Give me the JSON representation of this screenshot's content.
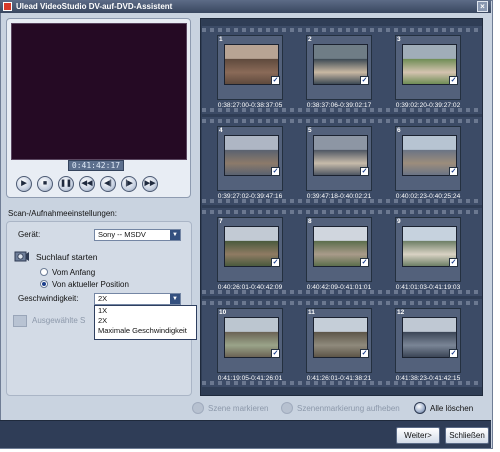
{
  "window": {
    "title": "Ulead VideoStudio DV-auf-DVD-Assistent",
    "close_glyph": "×"
  },
  "player": {
    "timecode": "0:41:42:17",
    "controls": [
      {
        "name": "play-button",
        "glyph": "▶"
      },
      {
        "name": "stop-button",
        "glyph": "■"
      },
      {
        "name": "pause-button",
        "glyph": "❚❚"
      },
      {
        "name": "rewind-button",
        "glyph": "◀◀"
      },
      {
        "name": "step-back-button",
        "glyph": "◀|"
      },
      {
        "name": "step-forward-button",
        "glyph": "|▶"
      },
      {
        "name": "fast-forward-button",
        "glyph": "▶▶"
      }
    ]
  },
  "settings": {
    "section_label": "Scan-/Aufnahmeeinstellungen:",
    "device_label": "Gerät:",
    "device_value": "Sony -- MSDV",
    "scan_start_label": "Suchlauf starten",
    "radio_from_start": "Vom Anfang",
    "radio_from_current": "Von aktueller Position",
    "speed_label": "Geschwindigkeit:",
    "speed_value": "2X",
    "speed_options": [
      "1X",
      "2X",
      "Maximale Geschwindigkeit"
    ],
    "save_selected_label": "Ausgewählte S"
  },
  "scenes": [
    {
      "num": "1",
      "timecode": "0:38:27:00-0:38:37:05"
    },
    {
      "num": "2",
      "timecode": "0:38:37:06-0:39:02:17"
    },
    {
      "num": "3",
      "timecode": "0:39:02:20-0:39:27:02"
    },
    {
      "num": "4",
      "timecode": "0:39:27:02-0:39:47:16"
    },
    {
      "num": "5",
      "timecode": "0:39:47:18-0:40:02:21"
    },
    {
      "num": "6",
      "timecode": "0:40:02:23-0:40:25:24"
    },
    {
      "num": "7",
      "timecode": "0:40:26:01-0:40:42:09"
    },
    {
      "num": "8",
      "timecode": "0:40:42:09-0:41:01:01"
    },
    {
      "num": "9",
      "timecode": "0:41:01:03-0:41:19:03"
    },
    {
      "num": "10",
      "timecode": "0:41:19:05-0:41:26:01"
    },
    {
      "num": "11",
      "timecode": "0:41:26:01-0:41:38:21"
    },
    {
      "num": "12",
      "timecode": "0:41:38:23-0:41:42:15"
    }
  ],
  "actions": {
    "mark_scene": "Szene markieren",
    "unmark_scene": "Szenenmarkierung aufheben",
    "delete_all": "Alle löschen"
  },
  "footer": {
    "next": "Weiter>",
    "close": "Schließen"
  },
  "colors": {
    "accent": "#2f3d57",
    "panel": "#c9d3e0",
    "selection": "#1c3f8c"
  }
}
